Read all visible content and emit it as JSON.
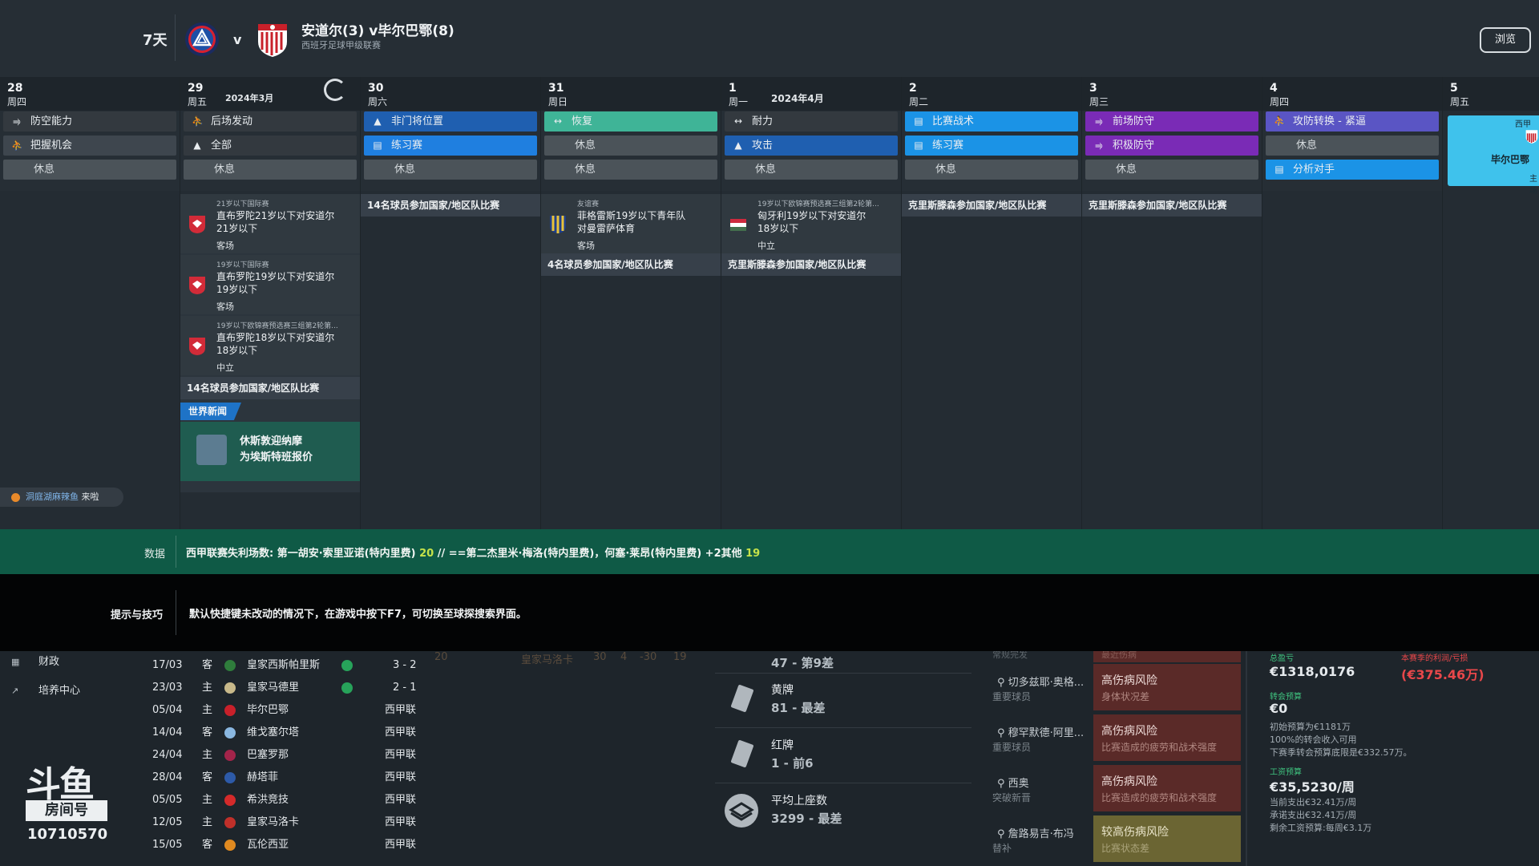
{
  "header": {
    "days_label": "7天",
    "vs": "v",
    "match_title": "安道尔(3) v毕尔巴鄂(8)",
    "competition": "西班牙足球甲级联赛",
    "browse_label": "浏览"
  },
  "calendar": {
    "days": [
      {
        "num": "28",
        "weekday": "周四",
        "month": ""
      },
      {
        "num": "29",
        "weekday": "周五",
        "month": "2024年3月"
      },
      {
        "num": "30",
        "weekday": "周六",
        "month": ""
      },
      {
        "num": "31",
        "weekday": "周日",
        "month": ""
      },
      {
        "num": "1",
        "weekday": "周一",
        "month": "2024年4月"
      },
      {
        "num": "2",
        "weekday": "周二",
        "month": ""
      },
      {
        "num": "3",
        "weekday": "周三",
        "month": ""
      },
      {
        "num": "4",
        "weekday": "周四",
        "month": ""
      },
      {
        "num": "5",
        "weekday": "周五",
        "month": ""
      }
    ],
    "sessions": [
      [
        "防空能力",
        "把握机会",
        "休息"
      ],
      [
        "后场发动",
        "全部",
        "休息"
      ],
      [
        "非门将位置",
        "练习赛",
        "休息"
      ],
      [
        "恢复",
        "休息",
        "休息"
      ],
      [
        "耐力",
        "攻击",
        "休息"
      ],
      [
        "比赛战术",
        "练习赛",
        "休息"
      ],
      [
        "前场防守",
        "积极防守",
        "休息"
      ],
      [
        "攻防转换 - 紧逼",
        "休息",
        "分析对手"
      ]
    ],
    "ghost_col": {
      "line1": "西甲",
      "line2": "毕尔巴鄂",
      "line3": "主场"
    },
    "events": {
      "d29_matches": [
        {
          "type": "21岁以下国际赛",
          "line1": "直布罗陀21岁以下对安道尔",
          "line2": "21岁以下",
          "venue": "客场"
        },
        {
          "type": "19岁以下国际赛",
          "line1": "直布罗陀19岁以下对安道尔",
          "line2": "19岁以下",
          "venue": "客场"
        },
        {
          "type": "19岁以下欧锦赛预选赛三组第2轮第...",
          "line1": "直布罗陀18岁以下对安道尔",
          "line2": "18岁以下",
          "venue": "中立"
        }
      ],
      "d29_bar": "14名球员参加国家/地区队比赛",
      "d30_bar": "14名球员参加国家/地区队比赛",
      "d31_match": {
        "type": "友谊赛",
        "line1": "菲格雷斯19岁以下青年队",
        "line2": "对曼雷萨体育",
        "venue": "客场"
      },
      "d31_bar": "4名球员参加国家/地区队比赛",
      "d1_match": {
        "type": "19岁以下欧锦赛预选赛三组第2轮第...",
        "line1": "匈牙利19岁以下对安道尔",
        "line2": "18岁以下",
        "venue": "中立"
      },
      "d1_bar": "克里斯滕森参加国家/地区队比赛",
      "d2_bar": "克里斯滕森参加国家/地区队比赛",
      "d3_bar": "克里斯滕森参加国家/地区队比赛"
    },
    "news": {
      "header": "世界新闻",
      "line1": "休斯敦迎纳摩",
      "line2": "为埃斯特班报价"
    },
    "chat": {
      "name": "洞庭湖麻辣鱼",
      "text": "来啦"
    }
  },
  "data_strip": {
    "label": "数据",
    "text_a": "西甲联赛失利场数: 第一胡安·索里亚诺(特内里费) ",
    "num_a": "20",
    "text_b": " // ==第二杰里米·梅洛(特内里费)，何塞·莱昂(特内里费) +2其他 ",
    "num_b": "19"
  },
  "tips": {
    "label": "提示与技巧",
    "text": "默认快捷键未改动的情况下，在游戏中按下F7，可切换至球探搜索界面。"
  },
  "sidebar": {
    "items": [
      {
        "label": "财政"
      },
      {
        "label": "培养中心"
      }
    ]
  },
  "watermark": {
    "brand": "斗鱼",
    "room_label": "房间号",
    "room_id": "10710570"
  },
  "fixtures": [
    {
      "date": "17/03",
      "ha": "客",
      "team": "皇家西斯帕里斯",
      "won": true,
      "result": "3 - 2",
      "crest": "#2f7d3c"
    },
    {
      "date": "23/03",
      "ha": "主",
      "team": "皇家马德里",
      "won": true,
      "result": "2 - 1",
      "crest": "#c8b98a"
    },
    {
      "date": "05/04",
      "ha": "主",
      "team": "毕尔巴鄂",
      "won": false,
      "result": "西甲联",
      "crest": "#c8202a"
    },
    {
      "date": "14/04",
      "ha": "客",
      "team": "维戈塞尔塔",
      "won": false,
      "result": "西甲联",
      "crest": "#8ab7e0"
    },
    {
      "date": "24/04",
      "ha": "主",
      "team": "巴塞罗那",
      "won": false,
      "result": "西甲联",
      "crest": "#a3244a"
    },
    {
      "date": "28/04",
      "ha": "客",
      "team": "赫塔菲",
      "won": false,
      "result": "西甲联",
      "crest": "#2d5aa8"
    },
    {
      "date": "05/05",
      "ha": "主",
      "team": "希洪竞技",
      "won": false,
      "result": "西甲联",
      "crest": "#d42a2a"
    },
    {
      "date": "12/05",
      "ha": "主",
      "team": "皇家马洛卡",
      "won": false,
      "result": "西甲联",
      "crest": "#c0302a"
    },
    {
      "date": "15/05",
      "ha": "客",
      "team": "瓦伦西亚",
      "won": false,
      "result": "西甲联",
      "crest": "#e08a20"
    }
  ],
  "ghost_table_row": {
    "rank": "20",
    "team": "皇家马洛卡",
    "c1": "30",
    "c2": "4",
    "c3": "-30",
    "c4": "19"
  },
  "stats": {
    "top_partial": "47 - 第9差",
    "items": [
      {
        "name": "黄牌",
        "value": "81 - 最差"
      },
      {
        "name": "红牌",
        "value": "1 - 前6"
      },
      {
        "name": "平均上座数",
        "value": "3299 - 最差"
      }
    ]
  },
  "injury_risks": {
    "top_partial_left": "常规完发",
    "top_partial_right": "最近伤病",
    "items": [
      {
        "player": "切多兹耶·奥格...",
        "role": "重要球员",
        "risk": "高伤病风险",
        "detail": "身体状况差",
        "level": "high"
      },
      {
        "player": "穆罕默德·阿里...",
        "role": "重要球员",
        "risk": "高伤病风险",
        "detail": "比赛造成的疲劳和战术强度",
        "level": "high"
      },
      {
        "player": "西奥",
        "role": "突破新晋",
        "risk": "高伤病风险",
        "detail": "比赛造成的疲劳和战术强度",
        "level": "high"
      },
      {
        "player": "詹路易吉·布冯",
        "role": "替补",
        "risk": "较高伤病风险",
        "detail": "比赛状态差",
        "level": "medium"
      }
    ]
  },
  "finance": {
    "balance_label": "总盈亏",
    "balance": "€1318,0176",
    "season_label": "本赛季的利润/亏损",
    "season_value": "(€375.46万)",
    "transfer_label": "转会预算",
    "transfer_value": "€0",
    "transfer_notes": [
      "初始预算为€1181万",
      "100%的转会收入可用",
      "下赛季转会预算底限是€332.57万。"
    ],
    "wage_label": "工资预算",
    "wage_value": "€35,5230/周",
    "wage_notes": [
      "当前支出€32.41万/周",
      "承诺支出€32.41万/周",
      "剩余工资预算:每周€3.1万"
    ]
  }
}
